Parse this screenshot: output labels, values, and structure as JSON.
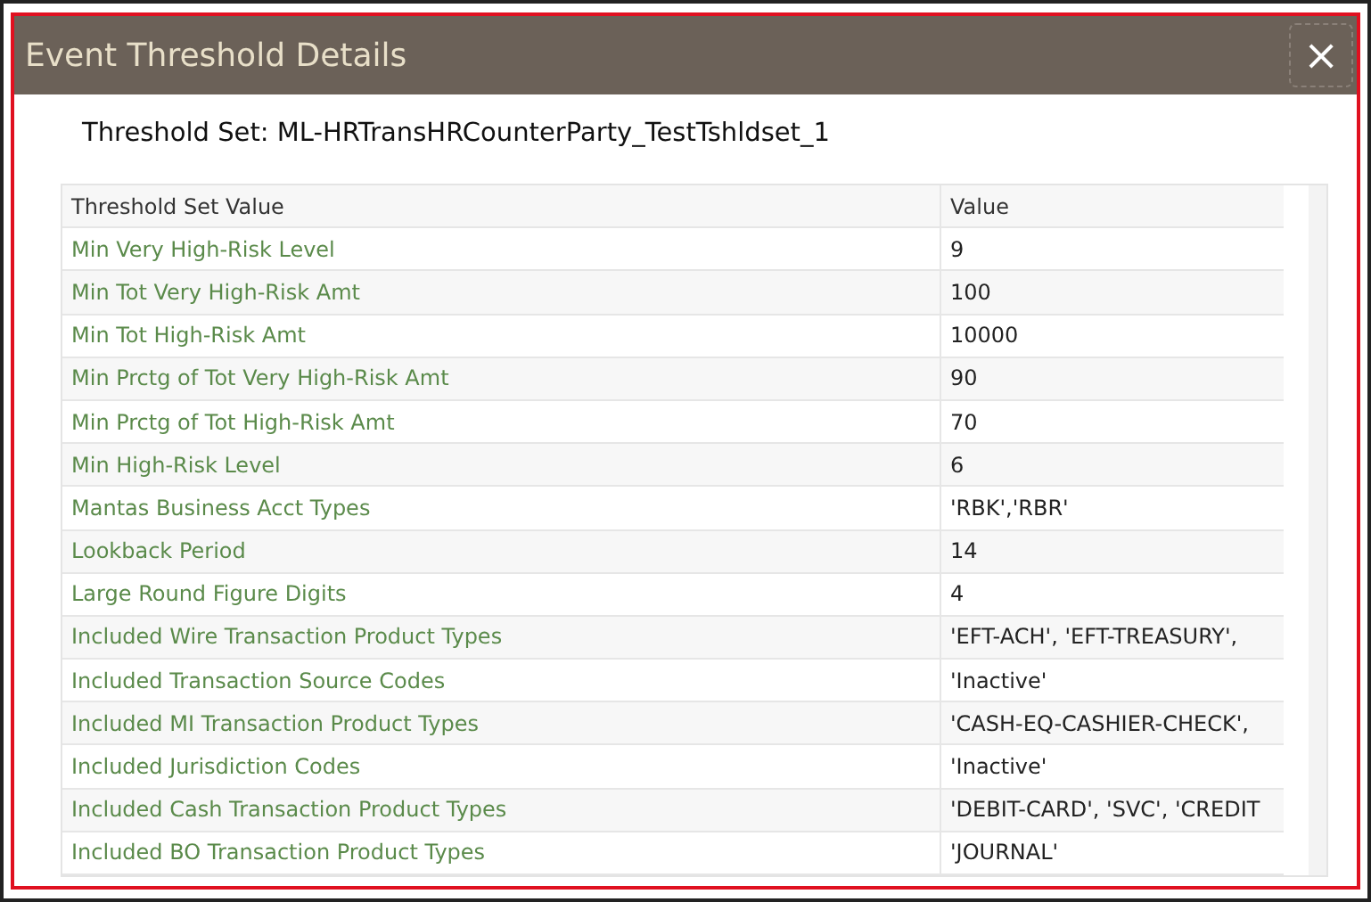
{
  "dialog": {
    "title": "Event Threshold Details",
    "close": "×"
  },
  "threshold_set": "Threshold Set: ML-HRTransHRCounterParty_TestTshldset_1",
  "table": {
    "columns": [
      "Threshold Set Value",
      "Value"
    ],
    "rows": [
      {
        "name": "Min Very High-Risk Level",
        "value": "9"
      },
      {
        "name": "Min Tot Very High-Risk Amt",
        "value": "100"
      },
      {
        "name": "Min Tot High-Risk Amt",
        "value": "10000"
      },
      {
        "name": "Min Prctg of Tot Very High-Risk Amt",
        "value": "90"
      },
      {
        "name": "Min Prctg of Tot High-Risk Amt",
        "value": "70"
      },
      {
        "name": "Min High-Risk Level",
        "value": "6"
      },
      {
        "name": "Mantas Business Acct Types",
        "value": "'RBK','RBR'"
      },
      {
        "name": "Lookback Period",
        "value": "14"
      },
      {
        "name": "Large Round Figure Digits",
        "value": "4"
      },
      {
        "name": "Included Wire Transaction Product Types",
        "value": "'EFT-ACH', 'EFT-TREASURY',"
      },
      {
        "name": "Included Transaction Source Codes",
        "value": "'Inactive'"
      },
      {
        "name": "Included MI Transaction Product Types",
        "value": "'CASH-EQ-CASHIER-CHECK',"
      },
      {
        "name": "Included Jurisdiction Codes",
        "value": "'Inactive'"
      },
      {
        "name": "Included Cash Transaction Product Types",
        "value": "'DEBIT-CARD', 'SVC', 'CREDIT"
      },
      {
        "name": "Included BO Transaction Product Types",
        "value": "'JOURNAL'"
      }
    ]
  }
}
